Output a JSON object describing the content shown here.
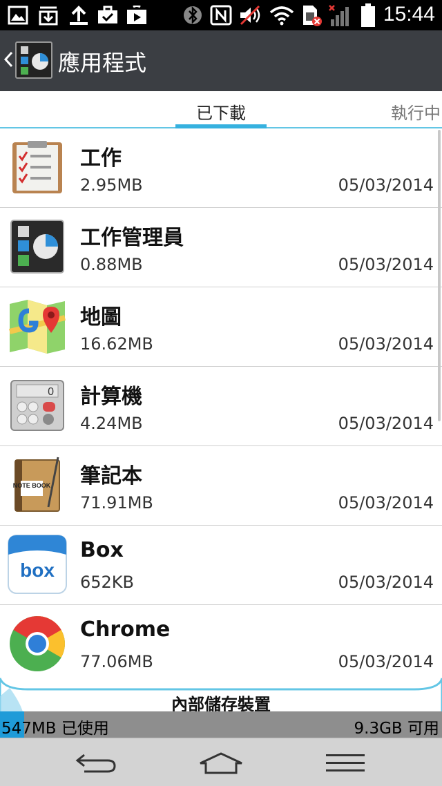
{
  "status_bar": {
    "time": "15:44",
    "icons": [
      "gallery-icon",
      "download-icon",
      "upload-icon",
      "briefcase-icon",
      "play-store-icon",
      "bluetooth-icon",
      "nfc-icon",
      "mute-icon",
      "wifi-icon",
      "sim-icon",
      "signal-icon",
      "battery-icon"
    ]
  },
  "action_bar": {
    "title": "應用程式"
  },
  "tabs": [
    {
      "label": "已下載",
      "active": true
    },
    {
      "label": "執行中",
      "active": false
    }
  ],
  "apps": [
    {
      "name": "工作",
      "size": "2.95MB",
      "date": "05/03/2014",
      "icon": "tasks-icon"
    },
    {
      "name": "工作管理員",
      "size": "0.88MB",
      "date": "05/03/2014",
      "icon": "task-manager-icon"
    },
    {
      "name": "地圖",
      "size": "16.62MB",
      "date": "05/03/2014",
      "icon": "maps-icon"
    },
    {
      "name": "計算機",
      "size": "4.24MB",
      "date": "05/03/2014",
      "icon": "calculator-icon"
    },
    {
      "name": "筆記本",
      "size": "71.91MB",
      "date": "05/03/2014",
      "icon": "notebook-icon"
    },
    {
      "name": "Box",
      "size": "652KB",
      "date": "05/03/2014",
      "icon": "box-icon"
    },
    {
      "name": "Chrome",
      "size": "77.06MB",
      "date": "05/03/2014",
      "icon": "chrome-icon"
    }
  ],
  "storage": {
    "label": "內部儲存裝置",
    "used": "547MB 已使用",
    "free": "9.3GB 可用",
    "used_fraction": 0.055
  },
  "calculator_display": "0",
  "notebook_text": "NOTE BOOK",
  "box_text": "box",
  "colors": {
    "status_bar": "#000000",
    "action_bar": "#3b3e43",
    "accent": "#36b1df",
    "storage_fill": "#1f9bd8",
    "storage_track": "#8e8e8e",
    "nav_bar": "#d3d3d3"
  }
}
